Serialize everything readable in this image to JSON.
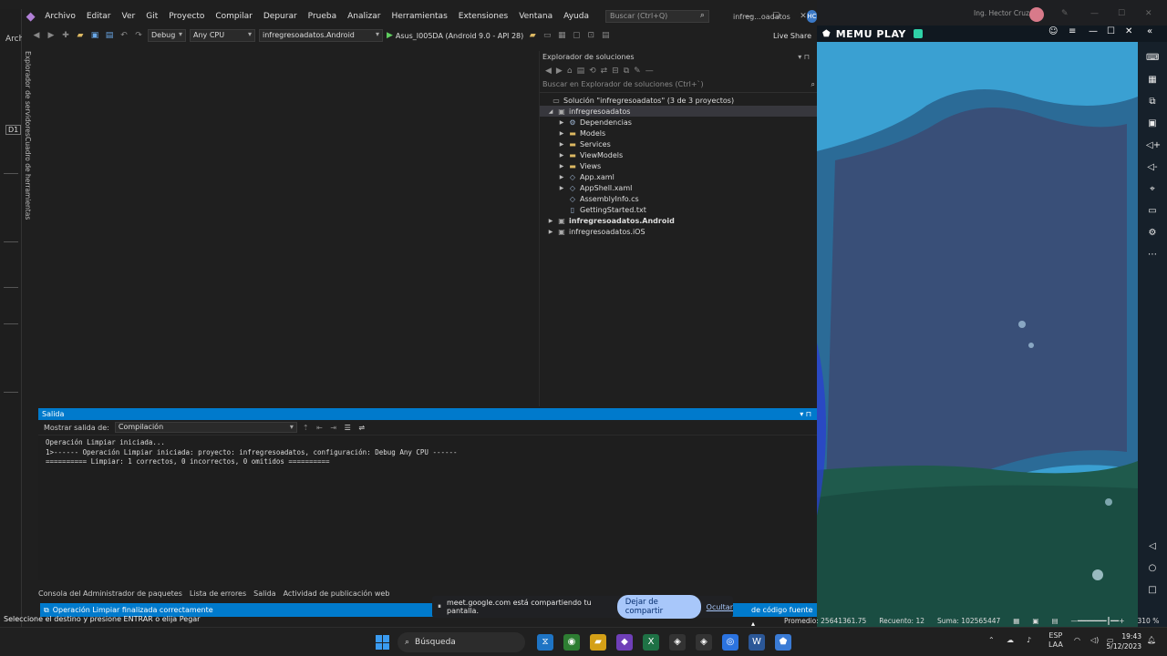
{
  "left_window": {
    "menu_label": "Arch",
    "chip": "D1"
  },
  "vs": {
    "menu": [
      "Archivo",
      "Editar",
      "Ver",
      "Git",
      "Proyecto",
      "Compilar",
      "Depurar",
      "Prueba",
      "Analizar",
      "Herramientas",
      "Extensiones",
      "Ventana",
      "Ayuda"
    ],
    "search_placeholder": "Buscar (Ctrl+Q)",
    "window_title": "infreg...oadatos",
    "user_initials": "HC",
    "toolbar": {
      "config": "Debug",
      "platform": "Any CPU",
      "startup_project": "infregresoadatos.Android",
      "run_target": "Asus_I005DA (Android 9.0 - API 28)",
      "live_share": "Live Share"
    },
    "side_tabs": [
      "Explorador de servidores",
      "Cuadro de herramientas"
    ],
    "solution_explorer": {
      "title": "Explorador de soluciones",
      "search_placeholder": "Buscar en Explorador de soluciones (Ctrl+`)",
      "solution": "Solución \"infregresoadatos\" (3 de 3 proyectos)",
      "project": "infregresoadatos",
      "items": [
        {
          "label": "Dependencias",
          "icon": "dependencies-icon",
          "expandable": true
        },
        {
          "label": "Models",
          "icon": "folder-icon",
          "expandable": true
        },
        {
          "label": "Services",
          "icon": "folder-icon",
          "expandable": true
        },
        {
          "label": "ViewModels",
          "icon": "folder-icon",
          "expandable": true
        },
        {
          "label": "Views",
          "icon": "folder-icon",
          "expandable": true
        },
        {
          "label": "App.xaml",
          "icon": "xaml-file-icon",
          "expandable": true
        },
        {
          "label": "AppShell.xaml",
          "icon": "xaml-file-icon",
          "expandable": true
        },
        {
          "label": "AssemblyInfo.cs",
          "icon": "cs-file-icon",
          "expandable": false
        },
        {
          "label": "GettingStarted.txt",
          "icon": "text-file-icon",
          "expandable": false
        }
      ],
      "other_projects": [
        "infregresoadatos.Android",
        "infregresoadatos.iOS"
      ]
    },
    "output": {
      "title": "Salida",
      "show_label": "Mostrar salida de:",
      "show_value": "Compilación",
      "lines": [
        "Operación Limpiar iniciada...",
        "1>------ Operación Limpiar iniciada: proyecto: infregresoadatos, configuración: Debug Any CPU ------",
        "========== Limpiar: 1 correctos, 0 incorrectos, 0 omitidos =========="
      ]
    },
    "bottom_tabs": [
      "Consola del Administrador de paquetes",
      "Lista de errores",
      "Salida",
      "Actividad de publicación web"
    ],
    "status_message": "Operación Limpiar finalizada correctamente",
    "status_right": "de código fuente ▴",
    "hint": "Seleccione el destino y presione ENTRAR o elija Pegar"
  },
  "meet": {
    "message": "meet.google.com está compartiendo tu pantalla.",
    "stop_label": "Dejar de compartir",
    "hide_label": "Ocultar"
  },
  "emulator": {
    "brand": "MEMU PLAY",
    "user_name": "Ing. Hector Cruz"
  },
  "excel_status": {
    "promedio": "Promedio: 25641361.75",
    "recuento": "Recuento: 12",
    "suma": "Suma: 102565447",
    "zoom": "310 %"
  },
  "taskbar": {
    "search_label": "Búsqueda",
    "lang": "ESP",
    "lang2": "LAA",
    "time": "19:43",
    "date": "5/12/2023"
  }
}
